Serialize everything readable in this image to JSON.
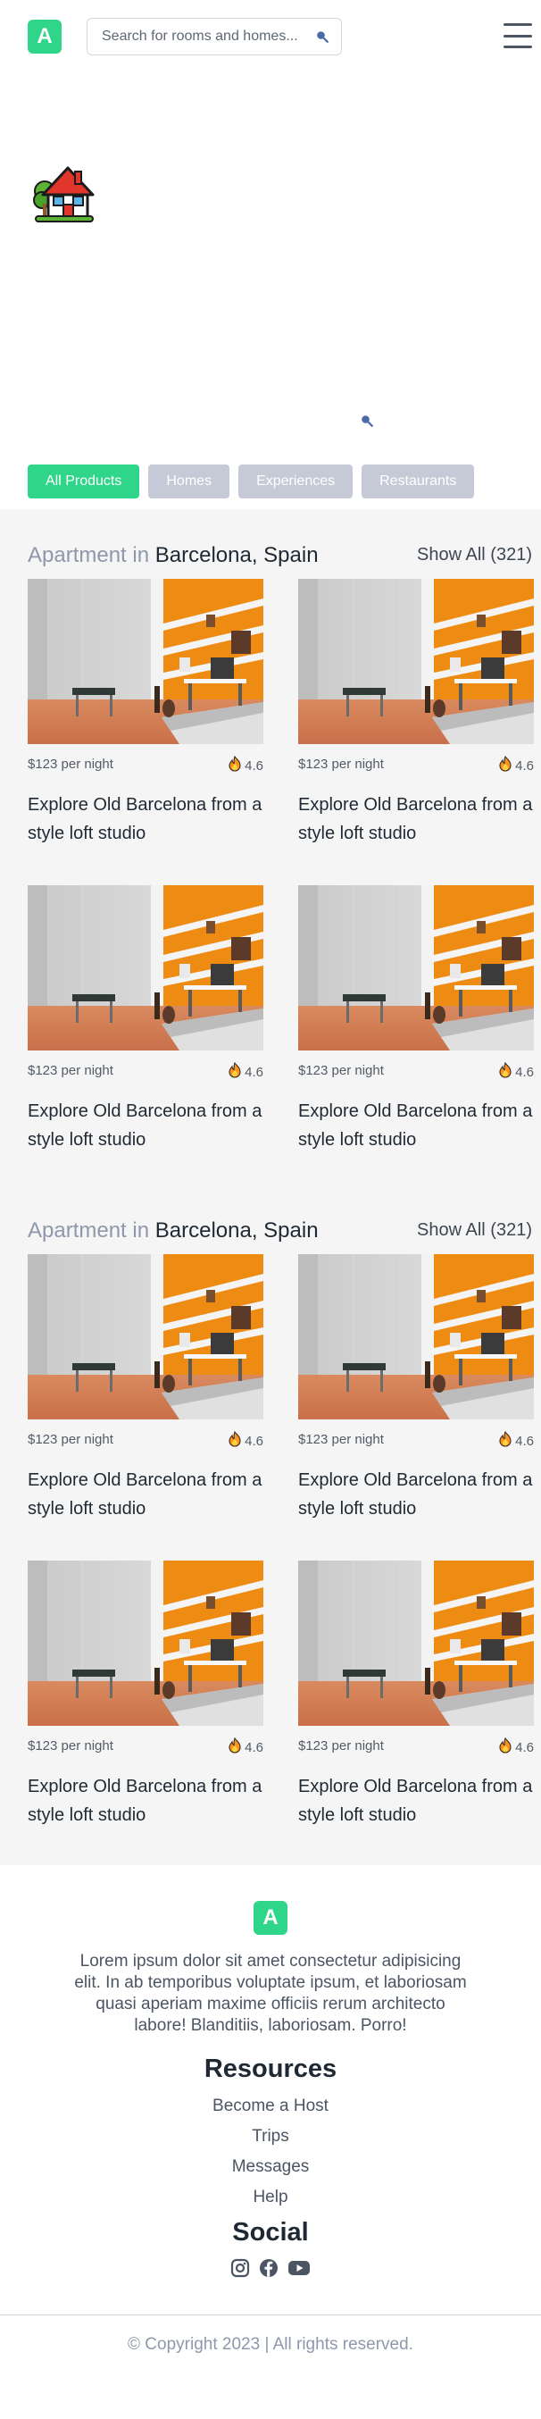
{
  "header": {
    "logo_letter": "A",
    "search_placeholder": "Search for rooms and homes...",
    "icons": {
      "search": "search-icon",
      "menu": "hamburger-menu-icon"
    }
  },
  "hero": {
    "image": "house-with-garden-emoji",
    "filters": [
      {
        "label": "All Products",
        "active": true
      },
      {
        "label": "Homes",
        "active": false
      },
      {
        "label": "Experiences",
        "active": false
      },
      {
        "label": "Restaurants",
        "active": false
      }
    ]
  },
  "colors": {
    "brand": "#2fd68a",
    "filter_inactive": "#c5cad6",
    "section_bg": "#f5f5f5",
    "muted_title": "#8f98ab"
  },
  "sections": [
    {
      "title_prefix": "Apartment in",
      "location": "Barcelona, Spain",
      "show_all": "Show All (321)",
      "listings": [
        {
          "price": "$123 per night",
          "rating": "4.6",
          "title": "Explore Old Barcelona from a style loft studio"
        },
        {
          "price": "$123 per night",
          "rating": "4.6",
          "title": "Explore Old Barcelona from a style loft studio"
        },
        {
          "price": "$123 per night",
          "rating": "4.6",
          "title": "Explore Old Barcelona from a style loft studio"
        },
        {
          "price": "$123 per night",
          "rating": "4.6",
          "title": "Explore Old Barcelona from a style loft studio"
        }
      ]
    },
    {
      "title_prefix": "Apartment in",
      "location": "Barcelona, Spain",
      "show_all": "Show All (321)",
      "listings": [
        {
          "price": "$123 per night",
          "rating": "4.6",
          "title": "Explore Old Barcelona from a style loft studio"
        },
        {
          "price": "$123 per night",
          "rating": "4.6",
          "title": "Explore Old Barcelona from a style loft studio"
        },
        {
          "price": "$123 per night",
          "rating": "4.6",
          "title": "Explore Old Barcelona from a style loft studio"
        },
        {
          "price": "$123 per night",
          "rating": "4.6",
          "title": "Explore Old Barcelona from a style loft studio"
        }
      ]
    }
  ],
  "footer": {
    "logo_letter": "A",
    "text": "Lorem ipsum dolor sit amet consectetur adipisicing elit. In ab temporibus voluptate ipsum, et laboriosam quasi aperiam maxime officiis rerum architecto labore! Blanditiis, laboriosam. Porro!",
    "resources_heading": "Resources",
    "links": [
      "Become a Host",
      "Trips",
      "Messages",
      "Help"
    ],
    "social_heading": "Social",
    "social_icons": [
      "instagram-icon",
      "facebook-icon",
      "youtube-icon"
    ],
    "copyright": "© Copyright 2023 | All rights reserved."
  }
}
